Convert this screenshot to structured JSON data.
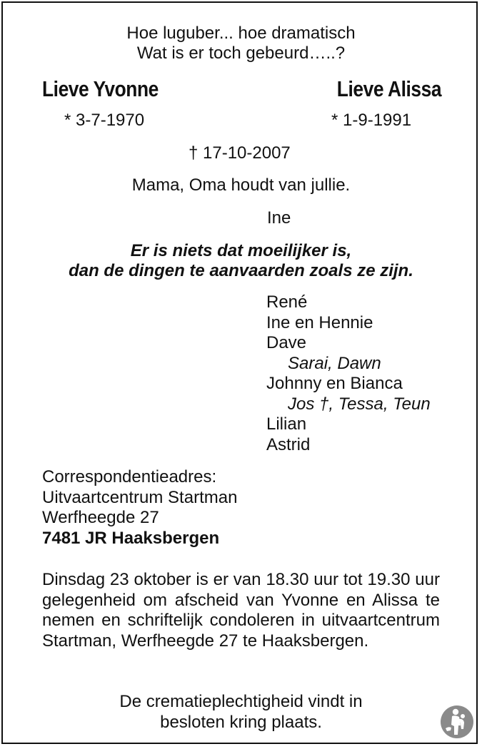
{
  "header": {
    "line1": "Hoe luguber... hoe dramatisch",
    "line2": "Wat is er toch gebeurd…..?"
  },
  "deceased": [
    {
      "name": "Lieve Yvonne",
      "birth": "* 3-7-1970"
    },
    {
      "name": "Lieve Alissa",
      "birth": "* 1-9-1991"
    }
  ],
  "death_date": "† 17-10-2007",
  "message": "Mama, Oma houdt van jullie.",
  "message_signature": "Ine",
  "quote": {
    "line1": "Er is niets dat moeilijker is,",
    "line2": "dan de dingen te aanvaarden zoals ze zijn."
  },
  "family": {
    "rene": "René",
    "ine_hennie": "Ine en Hennie",
    "dave": "Dave",
    "dave_children": "Sarai, Dawn",
    "johnny_bianca": "Johnny en Bianca",
    "johnny_children": "Jos †, Tessa, Teun",
    "lilian": "Lilian",
    "astrid": "Astrid"
  },
  "correspondence": {
    "label": "Correspondentieadres:",
    "name": "Uitvaartcentrum Startman",
    "street": "Werfheegde 27",
    "postal_city": "7481 JR Haaksbergen"
  },
  "visitation": "Dinsdag 23 oktober is er van 18.30 uur tot 19.30 uur gelegenheid om afscheid van Yvonne en Alissa te nemen en schriftelijk condoleren in uitvaartcentrum Startman, Werfheegde 27 te Haaksbergen.",
  "cremation": {
    "line1": "De crematieplechtigheid vindt in",
    "line2": "besloten kring plaats."
  },
  "logo_icon": "memorial-figure-icon"
}
